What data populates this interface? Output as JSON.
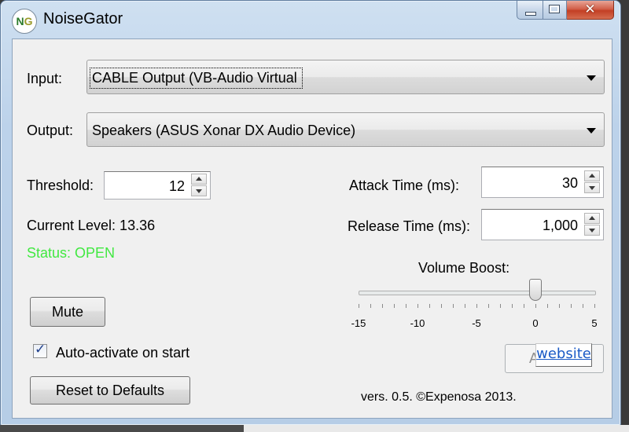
{
  "window": {
    "icon_text_n": "N",
    "icon_text_g": "G",
    "title": "NoiseGator",
    "caption": {
      "close_glyph": "✕"
    }
  },
  "input": {
    "label": "Input:",
    "selected": "CABLE Output (VB-Audio Virtual"
  },
  "output": {
    "label": "Output:",
    "selected": "Speakers (ASUS Xonar DX Audio Device)"
  },
  "threshold": {
    "label": "Threshold:",
    "value": "12"
  },
  "attack": {
    "label": "Attack Time (ms):",
    "value": "30"
  },
  "release": {
    "label": "Release Time (ms):",
    "value": "1,000"
  },
  "current_level": "Current Level: 13.36",
  "status": {
    "text": "Status: OPEN",
    "color": "#41e841"
  },
  "volume_boost": {
    "label": "Volume Boost:",
    "value": 0,
    "min": -15,
    "max": 5,
    "tick_labels": [
      "-15",
      "-10",
      "-5",
      "0",
      "5"
    ]
  },
  "buttons": {
    "mute": "Mute",
    "reset": "Reset to Defaults",
    "activate": "Activate"
  },
  "auto_activate": {
    "label": "Auto-activate on start",
    "checked": true,
    "tick": "✓"
  },
  "version": "vers. 0.5. ©Expenosa 2013.",
  "website": "website"
}
